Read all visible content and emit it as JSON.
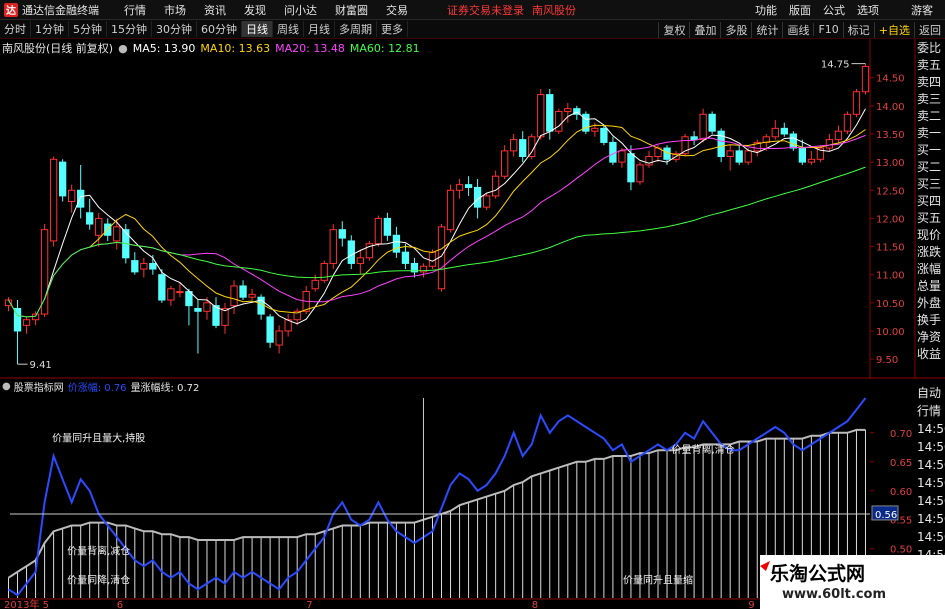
{
  "app": {
    "title": "通达信金融终端",
    "icon_label": "达"
  },
  "menu": [
    "行情",
    "市场",
    "资讯",
    "发现",
    "问小达",
    "财富圈",
    "交易"
  ],
  "notice": "证券交易未登录",
  "stock_name_top": "南风股份",
  "right_menu": [
    "功能",
    "版面",
    "公式",
    "选项",
    "游客"
  ],
  "periods": [
    "分时",
    "1分钟",
    "5分钟",
    "15分钟",
    "30分钟",
    "60分钟",
    "日线",
    "周线",
    "月线",
    "多周期",
    "更多"
  ],
  "active_period": "日线",
  "tools": [
    "复权",
    "叠加",
    "多股",
    "统计",
    "画线",
    "F10",
    "标记",
    "+自选",
    "返回"
  ],
  "chart_header": {
    "title": "南风股份(日线 前复权)"
  },
  "ma_legend": [
    {
      "label": "MA5: 13.90",
      "color": "#ffffff"
    },
    {
      "label": "MA10: 13.63",
      "color": "#ffd400"
    },
    {
      "label": "MA20: 13.48",
      "color": "#ff40ff"
    },
    {
      "label": "MA60: 12.81",
      "color": "#40ff40"
    }
  ],
  "indicator_header": {
    "name": "股票指标网",
    "series1": "价涨幅: 0.76",
    "series2": "量涨幅线: 0.72"
  },
  "side_panel": [
    "委比",
    "卖五",
    "卖四",
    "卖三",
    "卖二",
    "卖一",
    "买一",
    "买二",
    "买三",
    "买四",
    "买五",
    "现价",
    "涨跌",
    "涨幅",
    "总量",
    "外盘",
    "换手",
    "净资",
    "收益"
  ],
  "side_panel2": [
    "自动",
    "行情",
    "14:50",
    "14:50",
    "14:50",
    "14:50",
    "14:50",
    "14:50",
    "14:50",
    "14:50",
    "14:50",
    "14:50"
  ],
  "annotations": [
    {
      "text": "价量同升且量大,持股"
    },
    {
      "text": "价量背离,减仓"
    },
    {
      "text": "价量同降,清仓"
    },
    {
      "text": "价量背离,清仓"
    },
    {
      "text": "价量同升且量缩"
    }
  ],
  "watermark": {
    "line1": "乐淘公式网",
    "line2": "www.60lt.com"
  },
  "colors": {
    "up": "#ff3030",
    "down": "#54ffff",
    "ma5": "#ffffff",
    "ma10": "#ffd400",
    "ma20": "#ff40ff",
    "ma60": "#40ff40",
    "price_line": "#2a4bff",
    "volume_line": "#ffffff"
  },
  "chart_data": [
    {
      "type": "candlestick",
      "title": "南风股份(日线 前复权)",
      "ylim": [
        9.2,
        14.85
      ],
      "yticks": [
        "14.50",
        "14.00",
        "13.50",
        "13.00",
        "12.50",
        "12.00",
        "11.50",
        "11.00",
        "10.50",
        "10.00",
        "9.50"
      ],
      "ytick_values": [
        14.5,
        14.0,
        13.5,
        13.0,
        12.5,
        12.0,
        11.5,
        11.0,
        10.5,
        10.0,
        9.5
      ],
      "annotations": [
        {
          "text": "9.41",
          "value": 9.41
        },
        {
          "text": "14.75",
          "value": 14.75
        }
      ],
      "xlabels": [
        {
          "text": "2013年 5",
          "index": 0
        },
        {
          "text": "6",
          "index": 12
        },
        {
          "text": "7",
          "index": 33
        },
        {
          "text": "8",
          "index": 58
        },
        {
          "text": "9",
          "index": 82
        }
      ],
      "candles": [
        [
          10.45,
          10.6,
          10.35,
          10.55
        ],
        [
          10.4,
          10.55,
          9.41,
          10.0
        ],
        [
          10.1,
          10.25,
          9.95,
          10.2
        ],
        [
          10.2,
          10.35,
          10.1,
          10.3
        ],
        [
          10.3,
          11.9,
          10.25,
          11.8
        ],
        [
          11.6,
          13.1,
          11.5,
          13.05
        ],
        [
          13.0,
          13.05,
          12.3,
          12.4
        ],
        [
          12.3,
          12.6,
          12.1,
          12.5
        ],
        [
          12.5,
          12.95,
          12.0,
          12.2
        ],
        [
          12.1,
          12.35,
          11.8,
          11.9
        ],
        [
          11.7,
          12.1,
          11.5,
          12.0
        ],
        [
          11.9,
          12.0,
          11.6,
          11.7
        ],
        [
          11.6,
          12.0,
          11.45,
          11.85
        ],
        [
          11.8,
          11.9,
          11.2,
          11.3
        ],
        [
          11.25,
          11.4,
          11.0,
          11.05
        ],
        [
          11.1,
          11.3,
          10.95,
          11.2
        ],
        [
          11.2,
          11.35,
          11.0,
          11.1
        ],
        [
          11.0,
          11.1,
          10.5,
          10.55
        ],
        [
          10.55,
          10.8,
          10.45,
          10.75
        ],
        [
          10.7,
          10.85,
          10.6,
          10.7
        ],
        [
          10.7,
          10.75,
          10.1,
          10.45
        ],
        [
          10.4,
          10.55,
          9.6,
          10.35
        ],
        [
          10.35,
          10.6,
          10.2,
          10.5
        ],
        [
          10.45,
          10.6,
          10.05,
          10.1
        ],
        [
          10.1,
          10.5,
          9.95,
          10.4
        ],
        [
          10.45,
          10.9,
          10.3,
          10.8
        ],
        [
          10.8,
          10.9,
          10.55,
          10.6
        ],
        [
          10.6,
          10.75,
          10.55,
          10.65
        ],
        [
          10.6,
          10.65,
          10.2,
          10.3
        ],
        [
          10.25,
          10.3,
          9.7,
          9.8
        ],
        [
          9.75,
          10.1,
          9.6,
          10.0
        ],
        [
          10.0,
          10.3,
          9.9,
          10.2
        ],
        [
          10.2,
          10.4,
          10.1,
          10.35
        ],
        [
          10.35,
          10.8,
          10.3,
          10.7
        ],
        [
          10.75,
          11.0,
          10.7,
          10.9
        ],
        [
          10.9,
          11.25,
          10.85,
          11.2
        ],
        [
          11.2,
          11.9,
          11.1,
          11.8
        ],
        [
          11.8,
          11.95,
          11.5,
          11.65
        ],
        [
          11.6,
          11.7,
          11.1,
          11.2
        ],
        [
          11.2,
          11.45,
          11.0,
          11.3
        ],
        [
          11.3,
          11.6,
          11.25,
          11.55
        ],
        [
          11.55,
          12.05,
          11.5,
          12.0
        ],
        [
          12.0,
          12.1,
          11.6,
          11.7
        ],
        [
          11.7,
          11.85,
          11.3,
          11.4
        ],
        [
          11.4,
          11.55,
          11.1,
          11.2
        ],
        [
          11.2,
          11.3,
          10.95,
          11.05
        ],
        [
          11.05,
          11.2,
          10.95,
          11.15
        ],
        [
          11.15,
          11.45,
          11.1,
          11.4
        ],
        [
          10.75,
          11.9,
          10.7,
          11.85
        ],
        [
          11.8,
          12.6,
          11.75,
          12.5
        ],
        [
          12.5,
          12.7,
          12.35,
          12.6
        ],
        [
          12.6,
          12.75,
          12.4,
          12.55
        ],
        [
          12.55,
          12.7,
          12.0,
          12.2
        ],
        [
          12.2,
          12.45,
          12.15,
          12.4
        ],
        [
          12.4,
          12.85,
          12.35,
          12.75
        ],
        [
          12.75,
          13.3,
          12.7,
          13.2
        ],
        [
          13.2,
          13.5,
          13.1,
          13.4
        ],
        [
          13.4,
          13.55,
          13.0,
          13.1
        ],
        [
          13.1,
          13.5,
          13.05,
          13.45
        ],
        [
          13.45,
          14.3,
          13.4,
          14.2
        ],
        [
          14.2,
          14.3,
          13.4,
          13.55
        ],
        [
          13.55,
          13.95,
          13.5,
          13.9
        ],
        [
          13.9,
          14.05,
          13.7,
          13.95
        ],
        [
          13.95,
          14.0,
          13.75,
          13.85
        ],
        [
          13.85,
          13.9,
          13.5,
          13.55
        ],
        [
          13.55,
          13.7,
          13.45,
          13.6
        ],
        [
          13.6,
          13.65,
          13.3,
          13.35
        ],
        [
          13.35,
          13.45,
          12.95,
          13.0
        ],
        [
          13.0,
          13.25,
          12.9,
          13.2
        ],
        [
          13.15,
          13.3,
          12.5,
          12.65
        ],
        [
          12.65,
          13.0,
          12.6,
          12.95
        ],
        [
          12.95,
          13.2,
          12.9,
          13.1
        ],
        [
          13.1,
          13.3,
          13.0,
          13.25
        ],
        [
          13.25,
          13.3,
          12.95,
          13.05
        ],
        [
          13.05,
          13.2,
          13.0,
          13.15
        ],
        [
          13.15,
          13.5,
          13.1,
          13.45
        ],
        [
          13.45,
          13.55,
          13.3,
          13.4
        ],
        [
          13.4,
          13.95,
          13.35,
          13.85
        ],
        [
          13.85,
          13.9,
          13.5,
          13.55
        ],
        [
          13.55,
          13.6,
          13.0,
          13.1
        ],
        [
          13.1,
          13.3,
          12.85,
          13.2
        ],
        [
          13.2,
          13.3,
          12.95,
          13.0
        ],
        [
          13.0,
          13.25,
          12.95,
          13.2
        ],
        [
          13.2,
          13.4,
          13.1,
          13.35
        ],
        [
          13.35,
          13.5,
          13.2,
          13.45
        ],
        [
          13.45,
          13.75,
          13.4,
          13.6
        ],
        [
          13.6,
          13.7,
          13.45,
          13.5
        ],
        [
          13.5,
          13.55,
          13.2,
          13.25
        ],
        [
          13.25,
          13.4,
          12.95,
          13.0
        ],
        [
          13.0,
          13.2,
          12.95,
          13.05
        ],
        [
          13.05,
          13.3,
          13.0,
          13.25
        ],
        [
          13.25,
          13.5,
          13.2,
          13.4
        ],
        [
          13.4,
          13.65,
          13.35,
          13.55
        ],
        [
          13.55,
          13.9,
          13.5,
          13.85
        ],
        [
          13.85,
          14.3,
          13.8,
          14.25
        ],
        [
          14.25,
          14.75,
          14.2,
          14.7
        ]
      ]
    },
    {
      "type": "line",
      "title": "股票指标网",
      "ylim": [
        0.415,
        0.76
      ],
      "yticks": [
        "0.70",
        "0.65",
        "0.60",
        "0.55",
        "0.50",
        "0.45"
      ],
      "ytick_values": [
        0.7,
        0.65,
        0.6,
        0.55,
        0.5,
        0.45
      ],
      "marker": {
        "text": "0.56",
        "value": 0.56
      },
      "series": [
        {
          "name": "价涨幅",
          "values": [
            0.43,
            0.42,
            0.44,
            0.46,
            0.58,
            0.66,
            0.62,
            0.58,
            0.62,
            0.6,
            0.56,
            0.54,
            0.52,
            0.5,
            0.48,
            0.47,
            0.48,
            0.46,
            0.45,
            0.46,
            0.44,
            0.43,
            0.44,
            0.45,
            0.44,
            0.46,
            0.45,
            0.46,
            0.45,
            0.44,
            0.43,
            0.45,
            0.46,
            0.48,
            0.5,
            0.52,
            0.56,
            0.58,
            0.55,
            0.54,
            0.55,
            0.58,
            0.55,
            0.53,
            0.52,
            0.51,
            0.52,
            0.53,
            0.57,
            0.61,
            0.63,
            0.62,
            0.6,
            0.61,
            0.63,
            0.66,
            0.7,
            0.66,
            0.68,
            0.73,
            0.7,
            0.72,
            0.73,
            0.72,
            0.71,
            0.7,
            0.69,
            0.67,
            0.68,
            0.65,
            0.66,
            0.67,
            0.68,
            0.67,
            0.68,
            0.7,
            0.69,
            0.72,
            0.7,
            0.68,
            0.67,
            0.67,
            0.68,
            0.69,
            0.7,
            0.71,
            0.7,
            0.68,
            0.67,
            0.68,
            0.69,
            0.7,
            0.71,
            0.72,
            0.74,
            0.76
          ]
        },
        {
          "name": "量涨幅线",
          "values": [
            0.45,
            0.46,
            0.47,
            0.48,
            0.51,
            0.53,
            0.535,
            0.54,
            0.54,
            0.545,
            0.545,
            0.545,
            0.54,
            0.54,
            0.535,
            0.53,
            0.53,
            0.525,
            0.525,
            0.52,
            0.52,
            0.515,
            0.515,
            0.515,
            0.515,
            0.515,
            0.52,
            0.52,
            0.52,
            0.52,
            0.52,
            0.52,
            0.52,
            0.525,
            0.525,
            0.53,
            0.535,
            0.54,
            0.54,
            0.54,
            0.545,
            0.545,
            0.545,
            0.545,
            0.545,
            0.545,
            0.55,
            0.555,
            0.56,
            0.565,
            0.575,
            0.58,
            0.585,
            0.59,
            0.595,
            0.6,
            0.61,
            0.615,
            0.625,
            0.63,
            0.635,
            0.64,
            0.645,
            0.65,
            0.65,
            0.655,
            0.655,
            0.66,
            0.66,
            0.66,
            0.665,
            0.665,
            0.67,
            0.67,
            0.67,
            0.675,
            0.675,
            0.68,
            0.68,
            0.68,
            0.68,
            0.685,
            0.685,
            0.685,
            0.69,
            0.69,
            0.69,
            0.69,
            0.69,
            0.695,
            0.695,
            0.7,
            0.7,
            0.7,
            0.705,
            0.705
          ]
        }
      ]
    }
  ]
}
